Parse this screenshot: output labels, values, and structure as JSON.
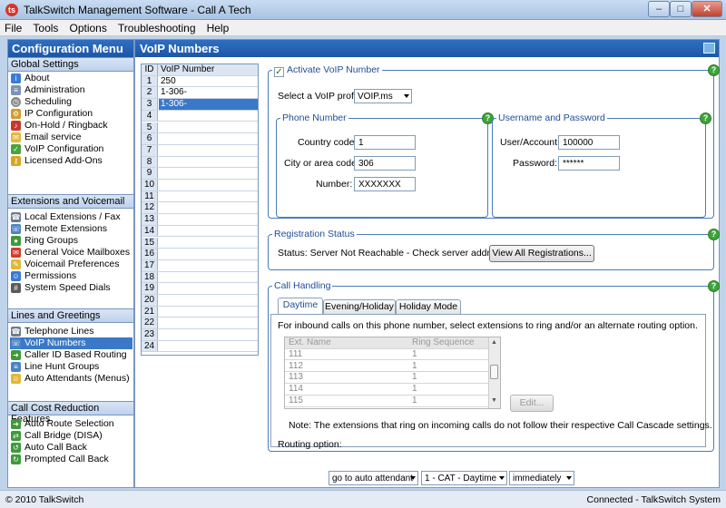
{
  "window": {
    "title": "TalkSwitch Management Software - Call A Tech"
  },
  "menu": [
    "File",
    "Tools",
    "Options",
    "Troubleshooting",
    "Help"
  ],
  "sidebar": {
    "title": "Configuration Menu",
    "sections": [
      {
        "title": "Global Settings",
        "items": [
          "About",
          "Administration",
          "Scheduling",
          "IP Configuration",
          "On-Hold / Ringback",
          "Email service",
          "VoIP Configuration",
          "Licensed Add-Ons"
        ]
      },
      {
        "title": "Extensions and Voicemail",
        "items": [
          "Local Extensions / Fax",
          "Remote Extensions",
          "Ring Groups",
          "General Voice Mailboxes",
          "Voicemail Preferences",
          "Permissions",
          "System Speed Dials"
        ]
      },
      {
        "title": "Lines and Greetings",
        "items": [
          "Telephone Lines",
          "VoIP Numbers",
          "Caller ID Based Routing",
          "Line Hunt Groups",
          "Auto Attendants (Menus)"
        ]
      },
      {
        "title": "Call Cost Reduction Features",
        "items": [
          "Auto Route Selection",
          "Call Bridge (DISA)",
          "Auto Call Back",
          "Prompted Call Back"
        ]
      }
    ],
    "selected": "VoIP Numbers"
  },
  "main": {
    "title": "VoIP Numbers",
    "numbers_table": {
      "headers": [
        "ID",
        "VoIP Number"
      ],
      "rows": [
        [
          "1",
          "250"
        ],
        [
          "2",
          "1-306-"
        ],
        [
          "3",
          "1-306-"
        ],
        [
          "4",
          ""
        ],
        [
          "5",
          ""
        ],
        [
          "6",
          ""
        ],
        [
          "7",
          ""
        ],
        [
          "8",
          ""
        ],
        [
          "9",
          ""
        ],
        [
          "10",
          ""
        ],
        [
          "11",
          ""
        ],
        [
          "12",
          ""
        ],
        [
          "13",
          ""
        ],
        [
          "14",
          ""
        ],
        [
          "15",
          ""
        ],
        [
          "16",
          ""
        ],
        [
          "17",
          ""
        ],
        [
          "18",
          ""
        ],
        [
          "19",
          ""
        ],
        [
          "20",
          ""
        ],
        [
          "21",
          ""
        ],
        [
          "22",
          ""
        ],
        [
          "23",
          ""
        ],
        [
          "24",
          ""
        ]
      ],
      "selected_row": 3
    },
    "activate": {
      "label": "Activate VoIP Number",
      "checked": true
    },
    "profile": {
      "label": "Select a VoIP profile:",
      "value": "VOIP.ms"
    },
    "phone_number": {
      "legend": "Phone Number",
      "country_label": "Country code:",
      "country_value": "1",
      "city_label": "City or area code:",
      "city_value": "306",
      "number_label": "Number:",
      "number_value": "XXXXXXX"
    },
    "credentials": {
      "legend": "Username and Password",
      "user_label": "User/Account:",
      "user_value": "100000",
      "password_label": "Password:",
      "password_value": "******"
    },
    "registration": {
      "legend": "Registration Status",
      "status_text": "Status:  Server Not Reachable - Check server address",
      "view_button": "View All Registrations..."
    },
    "call_handling": {
      "legend": "Call Handling",
      "tabs": [
        "Daytime",
        "Evening/Holiday",
        "Holiday Mode"
      ],
      "active_tab": "Daytime",
      "intro": "For inbound calls on this phone number, select extensions to ring and/or an alternate routing option.",
      "ext_table": {
        "headers": [
          "Ext.",
          "Name",
          "Ring Sequence"
        ],
        "rows": [
          [
            "111",
            "",
            "1"
          ],
          [
            "112",
            "",
            "1"
          ],
          [
            "113",
            "",
            "1"
          ],
          [
            "114",
            "",
            "1"
          ],
          [
            "115",
            "",
            "1"
          ]
        ]
      },
      "edit_button": "Edit...",
      "note": "Note: The extensions that ring on incoming calls do not follow their respective Call Cascade settings.",
      "routing_label": "Routing option:",
      "routing_option": "go to auto attendant",
      "routing_target": "1 - CAT - Daytime",
      "routing_timing": "immediately"
    },
    "help_icon": "?"
  },
  "status": {
    "left": "© 2010 TalkSwitch",
    "right": "Connected - TalkSwitch System"
  }
}
